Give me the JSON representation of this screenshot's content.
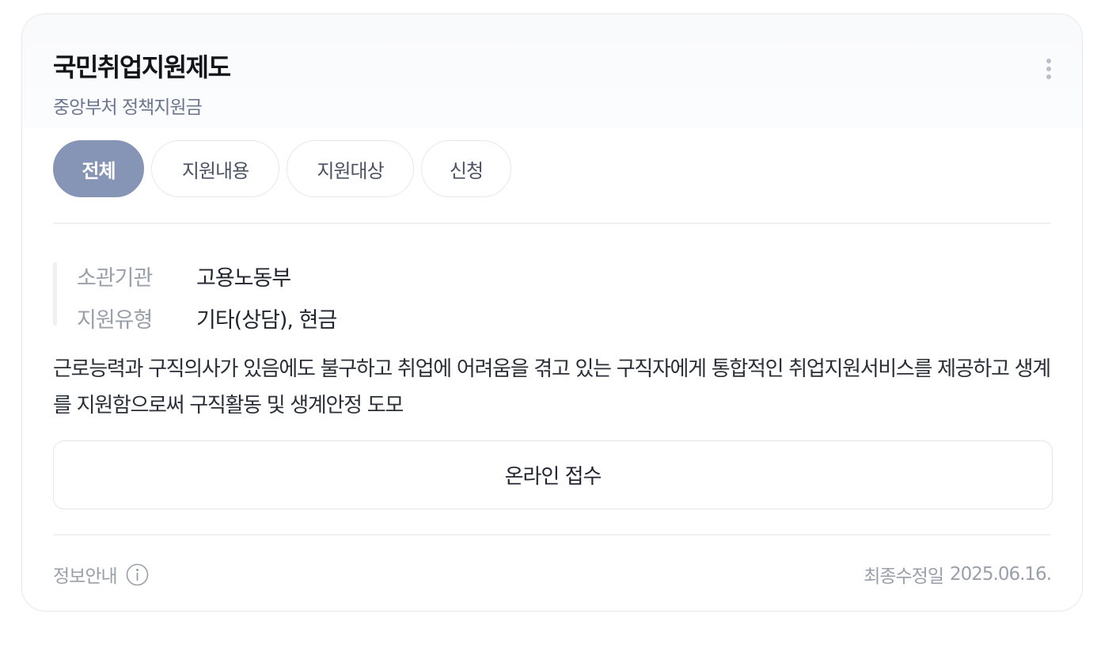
{
  "card": {
    "title": "국민취업지원제도",
    "subtitle": "중앙부처 정책지원금"
  },
  "tabs": [
    {
      "label": "전체",
      "active": true
    },
    {
      "label": "지원내용",
      "active": false
    },
    {
      "label": "지원대상",
      "active": false
    },
    {
      "label": "신청",
      "active": false
    }
  ],
  "info": [
    {
      "key": "소관기관",
      "value": "고용노동부"
    },
    {
      "key": "지원유형",
      "value": "기타(상담), 현금"
    }
  ],
  "description": "근로능력과 구직의사가 있음에도 불구하고 취업에 어려움을 겪고 있는 구직자에게 통합적인 취업지원서비스를 제공하고 생계를 지원함으로써 구직활동 및 생계안정 도모",
  "apply_button": "온라인 접수",
  "footer": {
    "info_label": "정보안내",
    "info_icon": "info-circle-icon",
    "updated_label": "최종수정일",
    "updated_date": "2025.06.16."
  },
  "colors": {
    "tab_active_bg": "#8694b5",
    "subtitle": "#6b7590",
    "border": "#e6e8ec"
  }
}
